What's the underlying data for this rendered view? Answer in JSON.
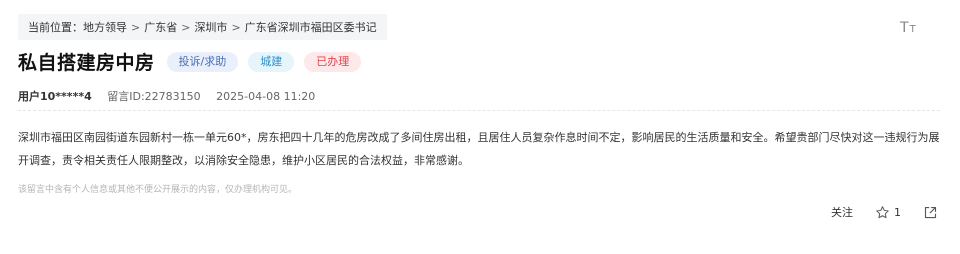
{
  "breadcrumb": {
    "prefix": "当前位置：",
    "items": [
      "地方领导",
      "广东省",
      "深圳市",
      "广东省深圳市福田区委书记"
    ],
    "separator": ">"
  },
  "font_toggle_icon": "font-size-icon",
  "post": {
    "title": "私自搭建房中房",
    "tags": {
      "type": "投诉/求助",
      "domain": "城建",
      "status": "已办理"
    },
    "user": "用户10*****4",
    "message_id": "留言ID:22783150",
    "datetime": "2025-04-08 11:20",
    "content": "深圳市福田区南园街道东园新村一栋一单元60*，房东把四十几年的危房改成了多间住房出租，且居住人员复杂作息时间不定，影响居民的生活质量和安全。希望贵部门尽快对这一违规行为展开调查，责令相关责任人限期整改，以消除安全隐患，维护小区居民的合法权益，非常感谢。",
    "privacy_note": "该留言中含有个人信息或其他不便公开展示的内容，仅办理机构可见。"
  },
  "actions": {
    "follow_label": "关注",
    "like_count": "1",
    "like_icon": "star-icon",
    "share_icon": "share-icon"
  },
  "colors": {
    "tag_type": "#4a6fb5",
    "tag_domain": "#2f8fc9",
    "tag_status": "#e0464f"
  }
}
